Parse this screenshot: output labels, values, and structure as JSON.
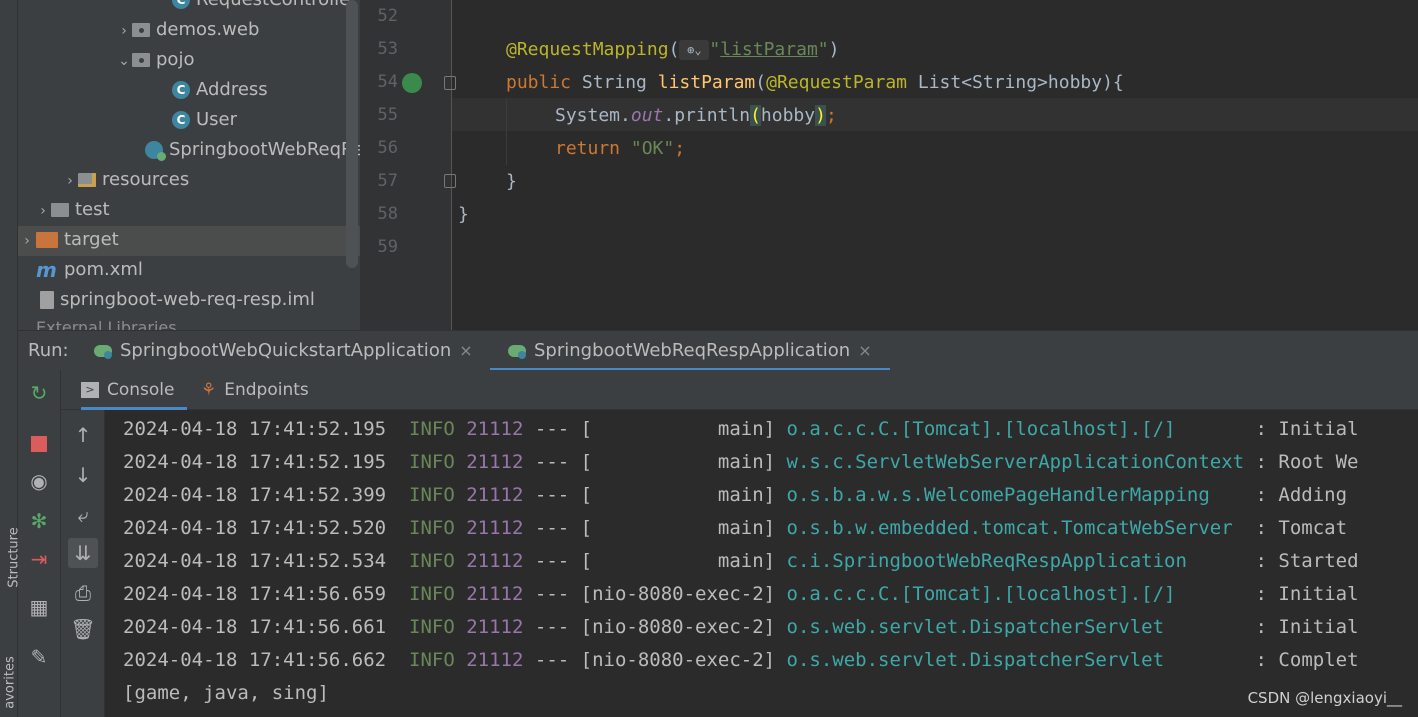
{
  "left_strip": {
    "structure": "Structure",
    "favorites": "avorites"
  },
  "project_tree": {
    "items": [
      {
        "label": "RequestControlle",
        "type": "class"
      },
      {
        "label": "demos.web",
        "type": "package"
      },
      {
        "label": "pojo",
        "type": "package"
      },
      {
        "label": "Address",
        "type": "class"
      },
      {
        "label": "User",
        "type": "class"
      },
      {
        "label": "SpringbootWebReqRe",
        "type": "spring-class"
      },
      {
        "label": "resources",
        "type": "resources-folder"
      },
      {
        "label": "test",
        "type": "folder"
      },
      {
        "label": "target",
        "type": "excluded-folder"
      },
      {
        "label": "pom.xml",
        "type": "maven-file"
      },
      {
        "label": "springboot-web-req-resp.iml",
        "type": "iml-file"
      }
    ],
    "partial": "External Libraries"
  },
  "editor": {
    "line_numbers": [
      "52",
      "53",
      "54",
      "55",
      "56",
      "57",
      "58",
      "59"
    ],
    "l53": {
      "ann": "@RequestMapping",
      "open": "(",
      "q1": "\"",
      "link": "listParam",
      "q2": "\"",
      "close": ")"
    },
    "l54": {
      "kw": "public",
      "type": " String ",
      "fn": "listParam",
      "open": "(",
      "ann": "@RequestParam",
      "rest": " List<String>hobby){"
    },
    "l55": {
      "a": "System.",
      "field": "out",
      "b": ".println",
      "open": "(",
      "arg": "hobby",
      "close": ")",
      "semi": ";"
    },
    "l56": {
      "kw": "return",
      "str": " \"OK\"",
      "semi": ";"
    },
    "l57": "}",
    "l58": "}"
  },
  "run": {
    "label": "Run:",
    "tabs": [
      "SpringbootWebQuickstartApplication",
      "SpringbootWebReqRespApplication"
    ],
    "close_glyph": "×"
  },
  "console_tabs": [
    "Console",
    "Endpoints"
  ],
  "log": [
    {
      "ts": "2024-04-18 17:41:52.195",
      "lvl": "INFO",
      "pid": "21112",
      "thread": "--- [           main]",
      "logger": "o.a.c.c.C.[Tomcat].[localhost].[/]",
      "msg": "       : Initial"
    },
    {
      "ts": "2024-04-18 17:41:52.195",
      "lvl": "INFO",
      "pid": "21112",
      "thread": "--- [           main]",
      "logger": "w.s.c.ServletWebServerApplicationContext",
      "msg": " : Root We"
    },
    {
      "ts": "2024-04-18 17:41:52.399",
      "lvl": "INFO",
      "pid": "21112",
      "thread": "--- [           main]",
      "logger": "o.s.b.a.w.s.WelcomePageHandlerMapping",
      "msg": "    : Adding"
    },
    {
      "ts": "2024-04-18 17:41:52.520",
      "lvl": "INFO",
      "pid": "21112",
      "thread": "--- [           main]",
      "logger": "o.s.b.w.embedded.tomcat.TomcatWebServer",
      "msg": "  : Tomcat"
    },
    {
      "ts": "2024-04-18 17:41:52.534",
      "lvl": "INFO",
      "pid": "21112",
      "thread": "--- [           main]",
      "logger": "c.i.SpringbootWebReqRespApplication",
      "msg": "      : Started"
    },
    {
      "ts": "2024-04-18 17:41:56.659",
      "lvl": "INFO",
      "pid": "21112",
      "thread": "--- [nio-8080-exec-2]",
      "logger": "o.a.c.c.C.[Tomcat].[localhost].[/]",
      "msg": "       : Initial"
    },
    {
      "ts": "2024-04-18 17:41:56.661",
      "lvl": "INFO",
      "pid": "21112",
      "thread": "--- [nio-8080-exec-2]",
      "logger": "o.s.web.servlet.DispatcherServlet",
      "msg": "        : Initial"
    },
    {
      "ts": "2024-04-18 17:41:56.662",
      "lvl": "INFO",
      "pid": "21112",
      "thread": "--- [nio-8080-exec-2]",
      "logger": "o.s.web.servlet.DispatcherServlet",
      "msg": "        : Complet"
    }
  ],
  "output_line": "[game, java, sing]",
  "watermark": "CSDN @lengxiaoyi__",
  "icons": {
    "rerun": "rerun-icon",
    "stop": "stop-icon",
    "camera": "camera-icon",
    "debug": "debug-icon",
    "exit": "exit-icon",
    "layout": "layout-icon",
    "pin": "pin-icon",
    "up": "up-arrow-icon",
    "down": "down-arrow-icon",
    "wrap": "soft-wrap-icon",
    "scroll": "scroll-to-end-icon",
    "print": "print-icon",
    "trash": "clear-icon"
  },
  "colors": {
    "keyword": "#cc7832",
    "annotation": "#bbb529",
    "string": "#6a8759",
    "function": "#ffc66d",
    "logger": "#3ea8a8",
    "pid": "#9876aa",
    "accent": "#4a88c7"
  }
}
